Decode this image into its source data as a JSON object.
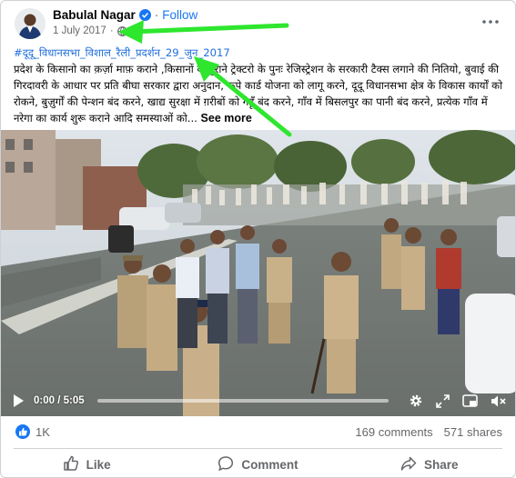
{
  "post": {
    "author": "Babulal Nagar",
    "follow_label": "Follow",
    "separator": "·",
    "date": "1 July 2017",
    "date_separator": "·",
    "hashtag": "#दूदू_विधानसभा_विशाल_रैली_प्रदर्शन_29_जुन_2017",
    "caption": "प्रदेश के किसानो का क़र्ज़ा माफ़ कराने ,किसानों के पुराने ट्रेक्टरो के पुनः रेजिस्ट्रेशन के सरकारी टैक्स लगाने की नितियो, बुवाई की गिरदावरी के आधार पर प्रति बीघा सरकार द्वारा अनुदान, रूपे कार्ड योजना को लागू करने, दूदू विधानसभा क्षेत्र के विकास कार्यों को रोकने, बुज़ुर्गों की पेन्शन बंद करने, खाद्य सुरक्षा में ग़रीबों को गेहूँ बंद करने, गाँव में बिसलपुर का पानी बंद करने, प्रत्येक गाँव में नरेगा का कार्य शुरू कराने आदि समस्याओं को...",
    "see_more": "See more"
  },
  "video": {
    "time": "0:00 / 5:05",
    "progress": 0
  },
  "stats": {
    "reactions": "1K",
    "comments": "169 comments",
    "shares": "571 shares"
  },
  "actions": {
    "like": "Like",
    "comment": "Comment",
    "share": "Share"
  },
  "colors": {
    "link_blue": "#1877f2",
    "hashtag_blue": "#216fdb",
    "annotation_green": "#2ee62e",
    "secondary_text": "#65676b"
  },
  "icons": [
    "verified-badge-icon",
    "globe-icon",
    "more-options-icon",
    "play-icon",
    "settings-gear-icon",
    "expand-icon",
    "picture-in-picture-icon",
    "volume-muted-icon",
    "like-reaction-icon",
    "like-thumb-icon",
    "comment-icon",
    "share-icon"
  ]
}
